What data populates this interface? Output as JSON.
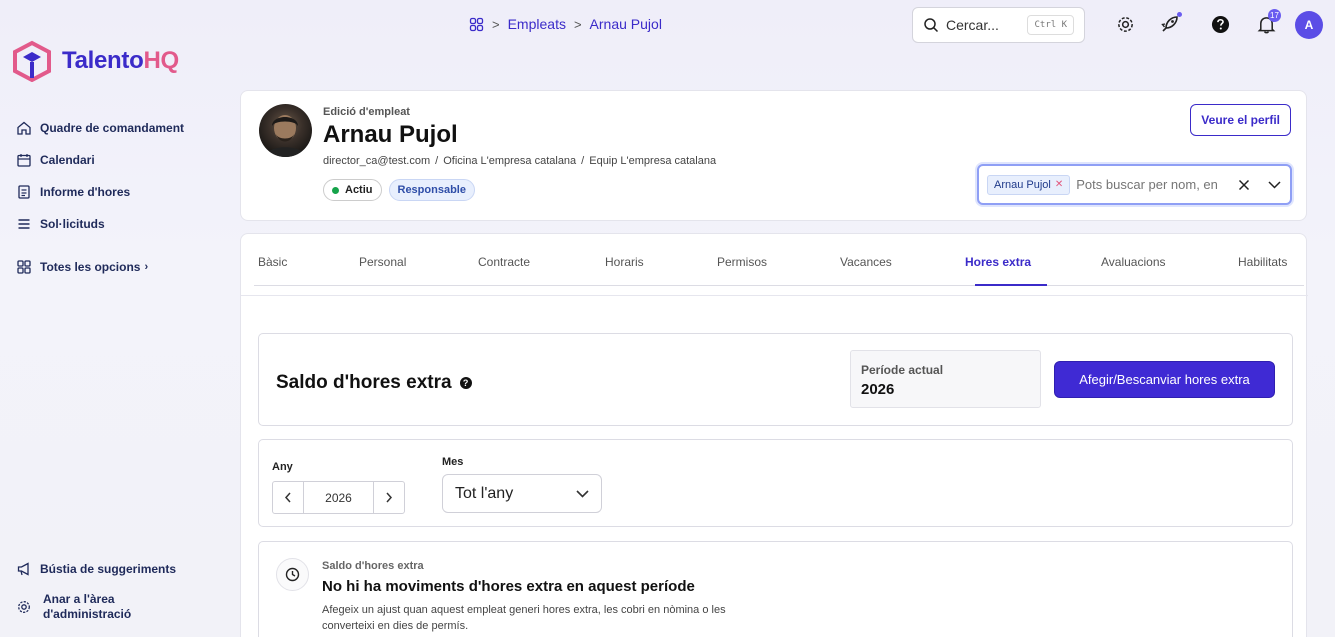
{
  "app": {
    "brand_main": "Talento",
    "brand_accent": "HQ"
  },
  "sidebar": {
    "items": [
      {
        "label": "Quadre de comandament",
        "icon": "home-icon"
      },
      {
        "label": "Calendari",
        "icon": "calendar-icon"
      },
      {
        "label": "Informe d'hores",
        "icon": "report-icon"
      },
      {
        "label": "Sol·licituds",
        "icon": "list-icon"
      }
    ],
    "all_options": "Totes les opcions",
    "feedback": "Bústia de suggeriments",
    "admin_line1": "Anar a l'àrea",
    "admin_line2": "d'administració"
  },
  "topbar": {
    "breadcrumb": [
      "Empleats",
      "Arnau Pujol"
    ],
    "search_label": "Cercar...",
    "search_shortcut": "Ctrl K",
    "notification_count": "17",
    "avatar_initial": "A"
  },
  "employee": {
    "subtitle": "Edició d'empleat",
    "name": "Arnau Pujol",
    "email": "director_ca@test.com",
    "office": "Oficina L'empresa catalana",
    "team": "Equip L'empresa catalana",
    "status": "Actiu",
    "role": "Responsable",
    "view_profile": "Veure el perfil",
    "selected_chip": "Arnau Pujol",
    "search_placeholder": "Pots buscar per nom, en"
  },
  "tabs": [
    "Bàsic",
    "Personal",
    "Contracte",
    "Horaris",
    "Permisos",
    "Vacances",
    "Hores extra",
    "Avaluacions",
    "Habilitats"
  ],
  "active_tab": "Hores extra",
  "balance": {
    "title": "Saldo d'hores extra",
    "period_label": "Període actual",
    "period_value": "2026",
    "action_button": "Afegir/Bescanviar hores extra"
  },
  "filters": {
    "year_label": "Any",
    "year_value": "2026",
    "month_label": "Mes",
    "month_value": "Tot l'any"
  },
  "empty_state": {
    "subtitle": "Saldo d'hores extra",
    "title": "No hi ha moviments d'hores extra en aquest període",
    "description": "Afegeix un ajust quan aquest empleat generi hores extra, les cobri en nòmina o les converteixi en dies de permís."
  },
  "colors": {
    "accent": "#3b2bc9",
    "brand_pink": "#e25a8b",
    "primary_button": "#3f2ad4"
  }
}
